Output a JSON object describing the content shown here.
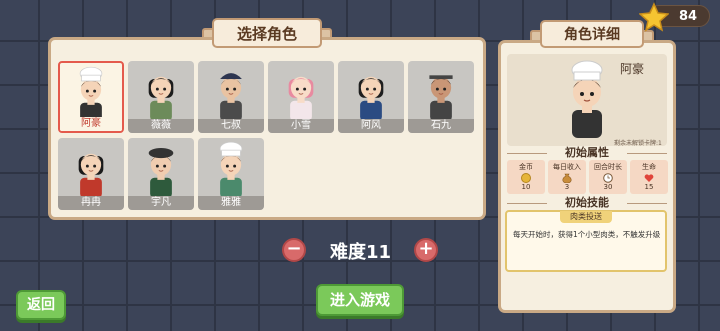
{
  "header": {
    "star_count": "84"
  },
  "select_panel": {
    "title": "选择角色",
    "characters": [
      {
        "name": "阿豪",
        "selected": true,
        "hair": "#2a1d14",
        "hat": "chef",
        "shirt": "#333",
        "skin": "#f5d4b8"
      },
      {
        "name": "薇薇",
        "selected": false,
        "hair": "#1c1c1c",
        "hat": "none",
        "shirt": "#6c8b5a",
        "skin": "#f5d4b8"
      },
      {
        "name": "七叔",
        "selected": false,
        "hair": "#6a6a6a",
        "hat": "cap",
        "shirt": "#4b4b4b",
        "skin": "#e9c3a2"
      },
      {
        "name": "小雪",
        "selected": false,
        "hair": "#e88aa0",
        "hat": "none",
        "shirt": "#f3e6ea",
        "skin": "#f8dcc8"
      },
      {
        "name": "阿风",
        "selected": false,
        "hair": "#1e1e1e",
        "hat": "none",
        "shirt": "#2b4b82",
        "skin": "#f5d4b8"
      },
      {
        "name": "石九",
        "selected": false,
        "hair": "#1a1a1a",
        "hat": "band",
        "shirt": "#444",
        "skin": "#c99676"
      },
      {
        "name": "冉冉",
        "selected": false,
        "hair": "#1a1a1a",
        "hat": "none",
        "shirt": "#c0392b",
        "skin": "#f5d4b8"
      },
      {
        "name": "宇凡",
        "selected": false,
        "hair": "#2a2a2a",
        "hat": "beret",
        "shirt": "#2e5a3c",
        "skin": "#f0cdb0"
      },
      {
        "name": "雅雅",
        "selected": false,
        "hair": "#5a3d2a",
        "hat": "chef",
        "shirt": "#4b8a6c",
        "skin": "#f5d4b8"
      }
    ]
  },
  "difficulty": {
    "label": "难度11",
    "minus": "−",
    "plus": "+"
  },
  "buttons": {
    "back": "返回",
    "enter": "进入游戏"
  },
  "detail_panel": {
    "title": "角色详细",
    "name": "阿豪",
    "unlock_text": "剩余未解锁卡牌:1",
    "attributes_title": "初始属性",
    "attributes": [
      {
        "label": "金币",
        "value": "10",
        "icon": "coin-icon"
      },
      {
        "label": "每日收入",
        "value": "3",
        "icon": "money-bag-icon"
      },
      {
        "label": "回合时长",
        "value": "30",
        "icon": "clock-icon"
      },
      {
        "label": "生命",
        "value": "15",
        "icon": "heart-icon"
      }
    ],
    "skills_title": "初始技能",
    "skill_name": "肉类投送",
    "skill_desc": "每天开始时，获得1个小型肉类，不触发升级"
  },
  "colors": {
    "accent_red": "#e45a4c",
    "button_green": "#7bc95a",
    "panel_bg": "#f6efe0"
  }
}
